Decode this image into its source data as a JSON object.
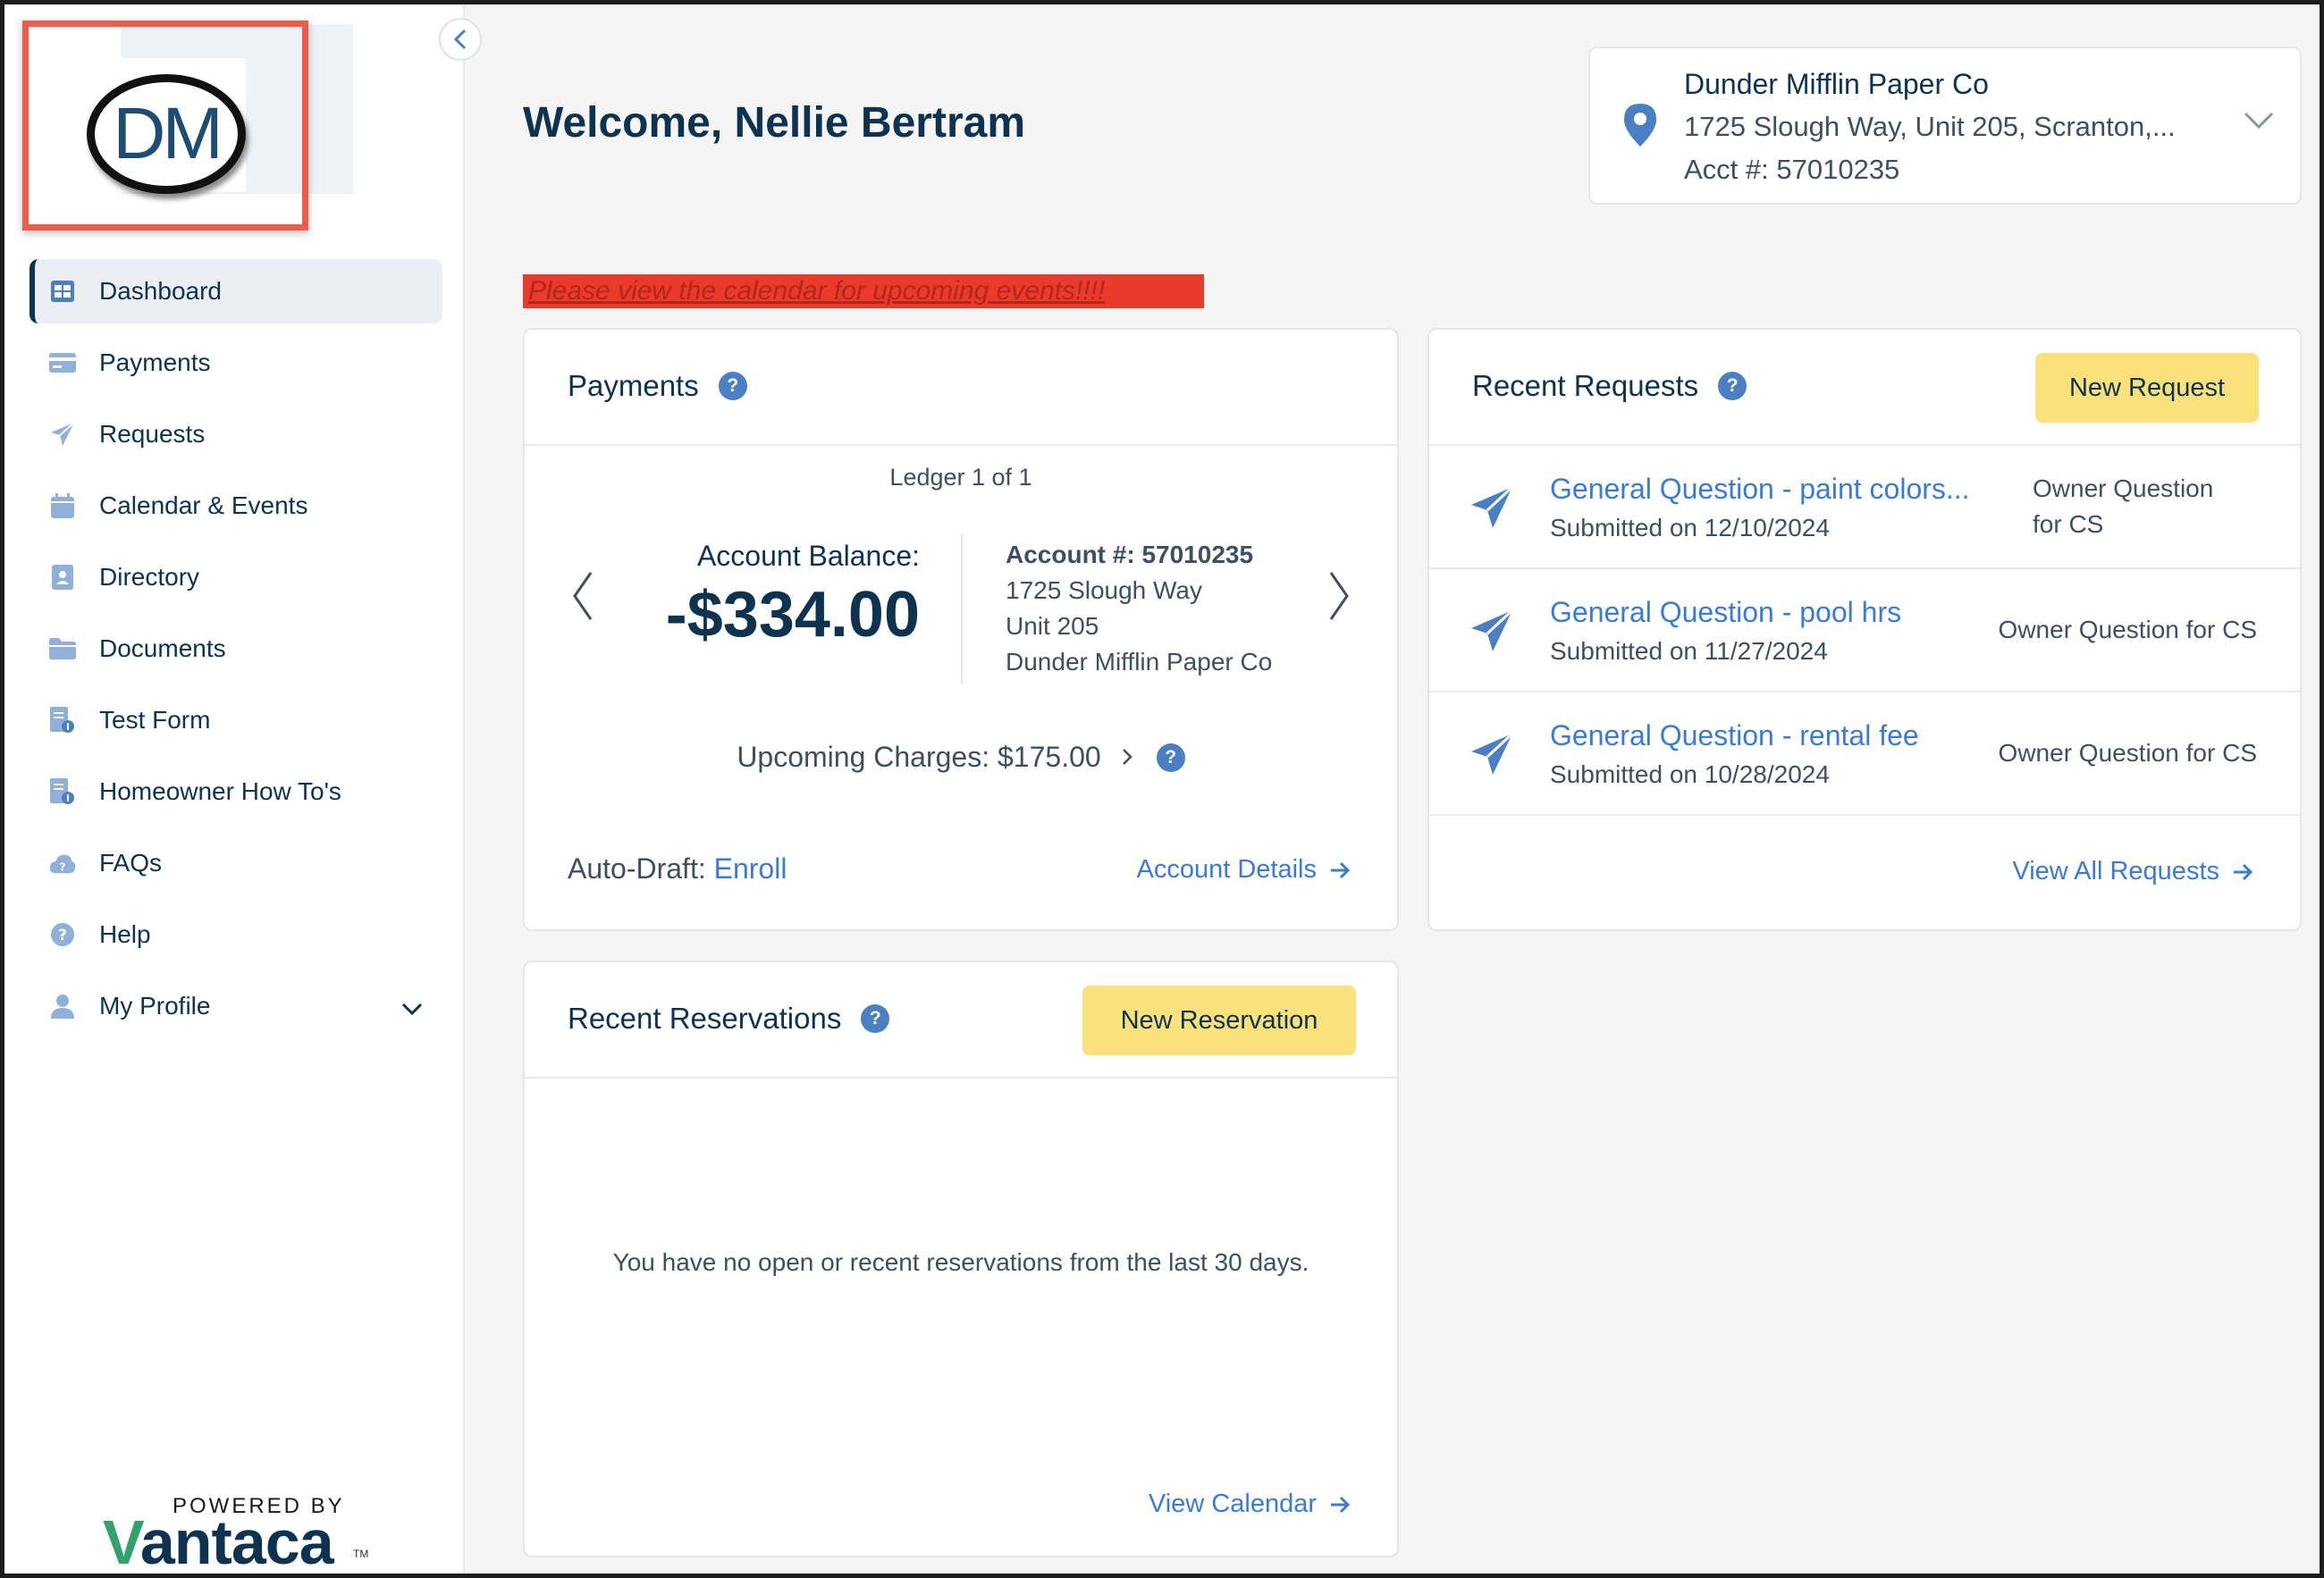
{
  "logo": {
    "text": "DM"
  },
  "sidebar": {
    "items": [
      {
        "label": "Dashboard",
        "icon": "dashboard-icon",
        "active": true
      },
      {
        "label": "Payments",
        "icon": "credit-card-icon"
      },
      {
        "label": "Requests",
        "icon": "paper-plane-icon"
      },
      {
        "label": "Calendar & Events",
        "icon": "calendar-icon"
      },
      {
        "label": "Directory",
        "icon": "contact-card-icon"
      },
      {
        "label": "Documents",
        "icon": "folder-icon"
      },
      {
        "label": "Test Form",
        "icon": "form-icon"
      },
      {
        "label": "Homeowner How To's",
        "icon": "form-icon"
      },
      {
        "label": "FAQs",
        "icon": "cloud-question-icon"
      },
      {
        "label": "Help",
        "icon": "help-circle-icon"
      },
      {
        "label": "My Profile",
        "icon": "user-icon"
      }
    ],
    "powered_by": "POWERED BY",
    "brand_v": "V",
    "brand_rest": "antaca",
    "trademark": "TM"
  },
  "header": {
    "welcome": "Welcome, Nellie Bertram"
  },
  "account_selector": {
    "name": "Dunder Mifflin Paper Co",
    "address": "1725 Slough Way, Unit 205, Scranton,...",
    "acct": "Acct #: 57010235"
  },
  "banner": {
    "text": "Please view the calendar for upcoming events!!!!"
  },
  "payments": {
    "title": "Payments",
    "ledger": "Ledger 1 of 1",
    "balance_label": "Account Balance:",
    "balance_value": "-$334.00",
    "account_number": "Account #: 57010235",
    "address_line1": "1725 Slough Way",
    "address_line2": "Unit 205",
    "owner": "Dunder Mifflin Paper Co",
    "upcoming": "Upcoming Charges: $175.00",
    "autodraft_label": "Auto-Draft: ",
    "autodraft_link": "Enroll",
    "details_link": "Account Details"
  },
  "requests": {
    "title": "Recent Requests",
    "new_button": "New Request",
    "items": [
      {
        "title": "General Question - paint colors...",
        "date": "Submitted on 12/10/2024",
        "category_line1": "Owner Question",
        "category_line2": "for CS"
      },
      {
        "title": "General Question - pool hrs",
        "date": "Submitted on 11/27/2024",
        "category_line1": "Owner Question for CS",
        "category_line2": ""
      },
      {
        "title": "General Question - rental fee",
        "date": "Submitted on 10/28/2024",
        "category_line1": "Owner Question for CS",
        "category_line2": ""
      }
    ],
    "view_all": "View All Requests"
  },
  "reservations": {
    "title": "Recent Reservations",
    "new_button": "New Reservation",
    "empty_text": "You have no open or recent reservations from the last 30 days.",
    "view_calendar": "View Calendar"
  },
  "colors": {
    "navy": "#0e3350",
    "link_blue": "#3a7bd5",
    "yellow_button": "#fbe17c",
    "banner_red": "#ea3a2c",
    "highlight_red": "#ec5c4a"
  }
}
